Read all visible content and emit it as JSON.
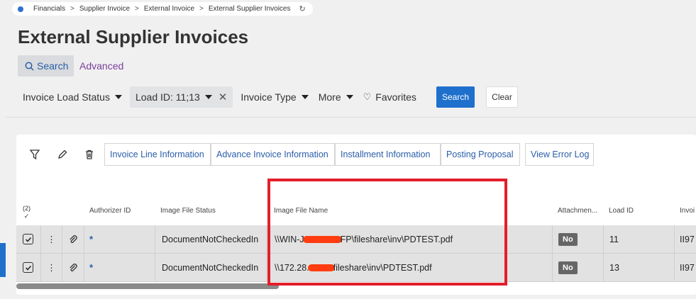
{
  "breadcrumb": [
    "Financials",
    "Supplier Invoice",
    "External Invoice",
    "External Supplier Invoices"
  ],
  "page_title": "External Supplier Invoices",
  "tabs": {
    "search": "Search",
    "advanced": "Advanced"
  },
  "filters": {
    "invoice_load_status": "Invoice Load Status",
    "load_id": "Load ID: 11;13",
    "invoice_type": "Invoice Type",
    "more": "More",
    "favorites": "Favorites"
  },
  "buttons": {
    "search": "Search",
    "clear": "Clear"
  },
  "commands": [
    "Invoice Line Information",
    "Advance Invoice Information",
    "Installment Information",
    "Posting Proposal",
    "View Error Log"
  ],
  "grid": {
    "selected_count": "(2)",
    "columns": {
      "authorizer_id": "Authorizer ID",
      "image_file_status": "Image File Status",
      "image_file_name": "Image File Name",
      "attachments": "Attachmen...",
      "load_id": "Load ID",
      "invoice": "Invoi"
    },
    "rows": [
      {
        "authorizer": "*",
        "status": "DocumentNotCheckedIn",
        "file_prefix": "\\\\WIN-J",
        "file_suffix": "FP\\fileshare\\inv\\PDTEST.pdf",
        "attachment": "No",
        "load_id": "11",
        "invoice": "II97"
      },
      {
        "authorizer": "*",
        "status": "DocumentNotCheckedIn",
        "file_prefix": "\\\\172.28.",
        "file_suffix": "fileshare\\inv\\PDTEST.pdf",
        "attachment": "No",
        "load_id": "13",
        "invoice": "II97"
      }
    ]
  },
  "colors": {
    "accent": "#1f6fcc",
    "highlight": "#e41e2b",
    "redaction": "#ff3d10"
  }
}
